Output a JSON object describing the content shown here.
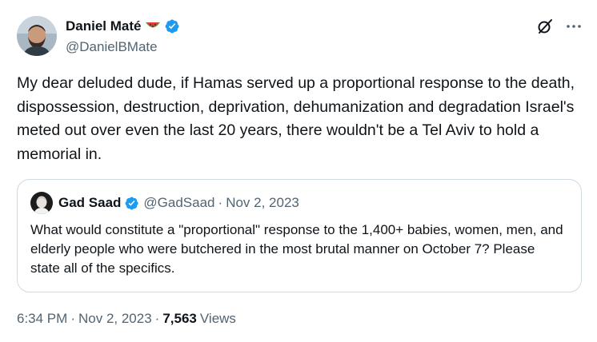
{
  "author": {
    "name": "Daniel Maté",
    "handle": "@DanielBMate",
    "name_emoji": "watermelon-emoji",
    "verified": true
  },
  "tweet": {
    "text": "My dear deluded dude, if Hamas served up a proportional response to the death, dispossession, destruction, deprivation, dehumanization and degradation Israel's meted out  over even the last 20 years, there wouldn't be a Tel Aviv to hold a memorial in."
  },
  "quote": {
    "name": "Gad Saad",
    "handle": "@GadSaad",
    "separator": "·",
    "date": "Nov 2, 2023",
    "text": "What would constitute a \"proportional\" response to the 1,400+ babies, women, men, and elderly people who were butchered in the most brutal manner on October 7?  Please state all of the specifics."
  },
  "meta": {
    "time": "6:34 PM",
    "separator": "·",
    "date": "Nov 2, 2023",
    "views_count": "7,563",
    "views_label": "Views"
  },
  "icons": {
    "grok": "grok-icon",
    "more": "more-icon",
    "verified": "verified-badge-icon"
  },
  "colors": {
    "text_primary": "#0f1419",
    "text_secondary": "#536471",
    "verified_blue": "#1d9bf0",
    "border": "#cfd9de"
  }
}
